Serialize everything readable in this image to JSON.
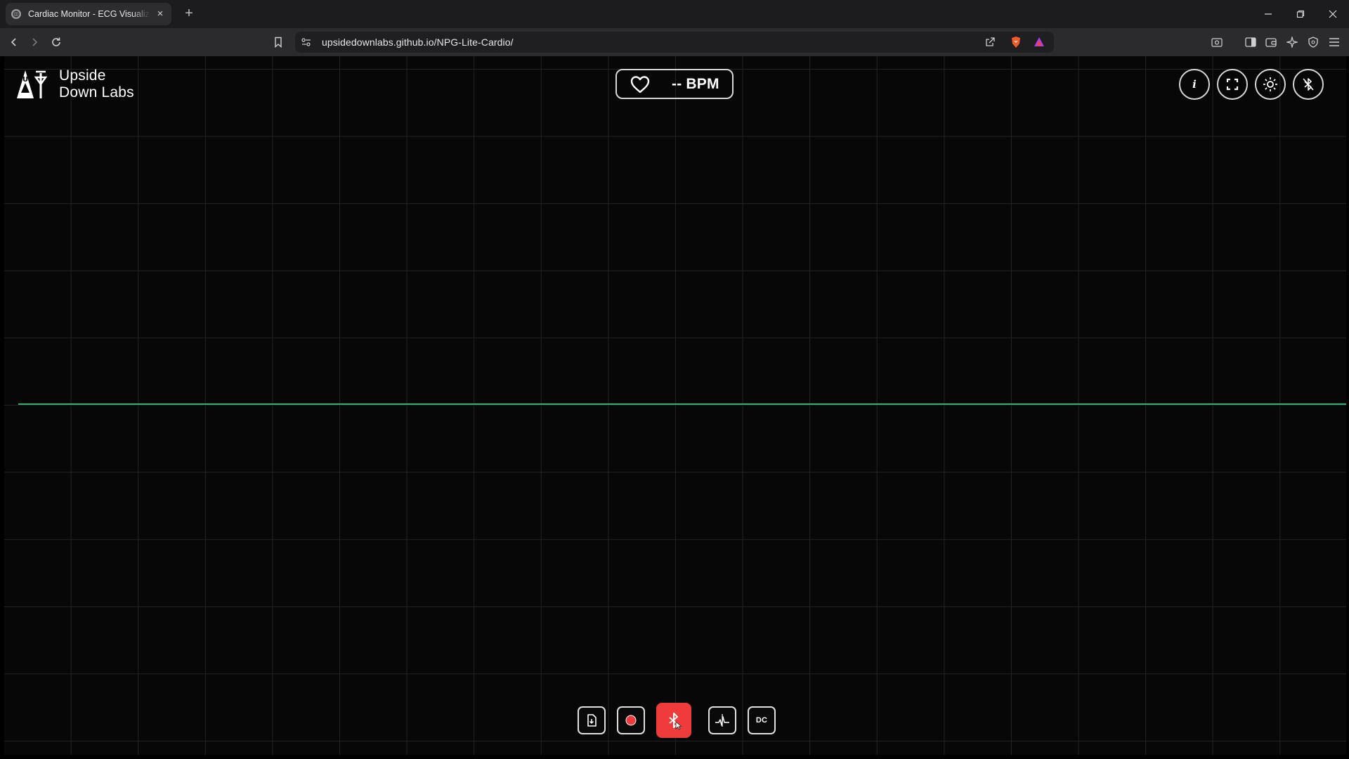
{
  "browser": {
    "tab_title": "Cardiac Monitor - ECG Visualizat",
    "url": "upsidedownlabs.github.io/NPG-Lite-Cardio/"
  },
  "app": {
    "logo_line1": "Upside",
    "logo_line2": "Down Labs",
    "bpm_text": "-- BPM",
    "trace_color": "#2fb070",
    "accent_color": "#ef3b3b",
    "top_buttons": [
      "info-icon",
      "fullscreen-icon",
      "theme-sun-icon",
      "bluetooth-off-icon"
    ],
    "bottom_buttons": [
      "save-file-icon",
      "record-icon",
      "bluetooth-icon",
      "filter-icon"
    ],
    "dc_label": "DC"
  }
}
